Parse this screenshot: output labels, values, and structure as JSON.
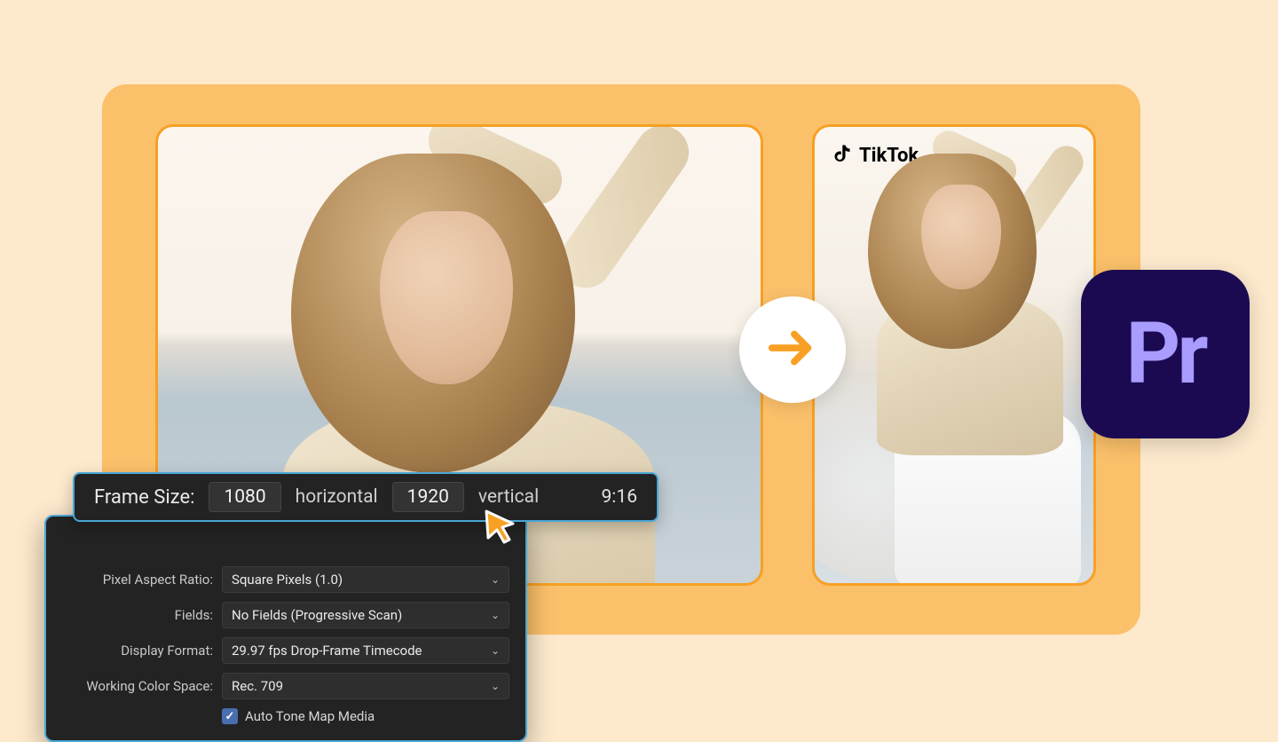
{
  "tiktok": {
    "label": "TikTok"
  },
  "pr": {
    "label": "Pr"
  },
  "frame_bar": {
    "title": "Frame Size:",
    "width": "1080",
    "h_label": "horizontal",
    "height": "1920",
    "v_label": "vertical",
    "ratio": "9:16"
  },
  "settings": {
    "pixel_aspect_label": "Pixel Aspect Ratio:",
    "pixel_aspect_value": "Square Pixels (1.0)",
    "fields_label": "Fields:",
    "fields_value": "No Fields (Progressive Scan)",
    "display_format_label": "Display Format:",
    "display_format_value": "29.97 fps Drop-Frame Timecode",
    "color_space_label": "Working Color Space:",
    "color_space_value": "Rec. 709",
    "auto_tone_label": "Auto Tone Map Media",
    "auto_tone_checked": true
  }
}
